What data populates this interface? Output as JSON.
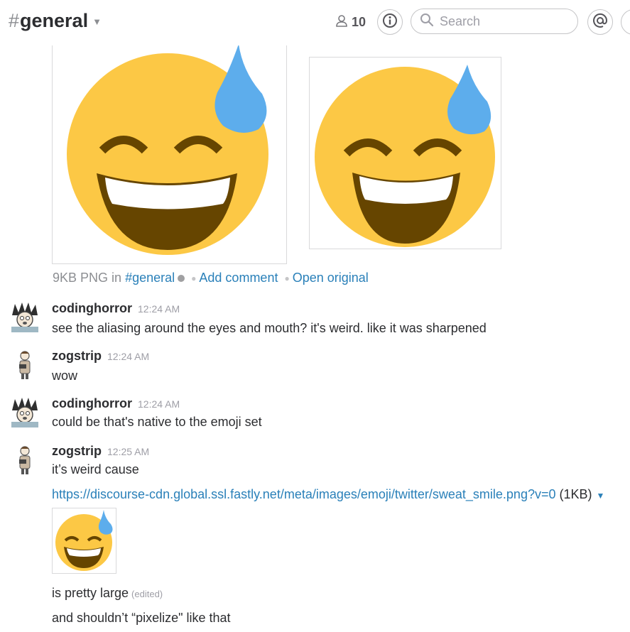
{
  "header": {
    "hash": "#",
    "channel": "general",
    "member_count": "10",
    "search_placeholder": "Search"
  },
  "attachment": {
    "size_type": "9KB PNG",
    "in_text": "in",
    "channel_link": "#general",
    "add_comment": "Add comment",
    "open_original": "Open original"
  },
  "messages": [
    {
      "author": "codinghorror",
      "time": "12:24 AM",
      "text": "see the aliasing around the eyes and mouth? it's weird. like it was sharpened"
    },
    {
      "author": "zogstrip",
      "time": "12:24 AM",
      "text": "wow"
    },
    {
      "author": "codinghorror",
      "time": "12:24 AM",
      "text": "could be that's native to the emoji set"
    },
    {
      "author": "zogstrip",
      "time": "12:25 AM",
      "text": "it’s weird cause"
    }
  ],
  "link": {
    "url": "https://discourse-cdn.global.ssl.fastly.net/meta/images/emoji/twitter/sweat_smile.png?v=0",
    "size": "(1KB)"
  },
  "followups": [
    {
      "text": "is pretty large",
      "edited": "(edited)"
    },
    {
      "text": "and shouldn’t “pixelize\" like that"
    }
  ],
  "icons": [
    "channel-caret-icon",
    "member-icon",
    "info-icon",
    "search-icon",
    "mention-icon",
    "sweat-smile-emoji"
  ],
  "colors": {
    "link": "#2a80b9",
    "emoji_face": "#fcc845",
    "emoji_drop": "#5dadec",
    "emoji_mouth": "#664500"
  }
}
